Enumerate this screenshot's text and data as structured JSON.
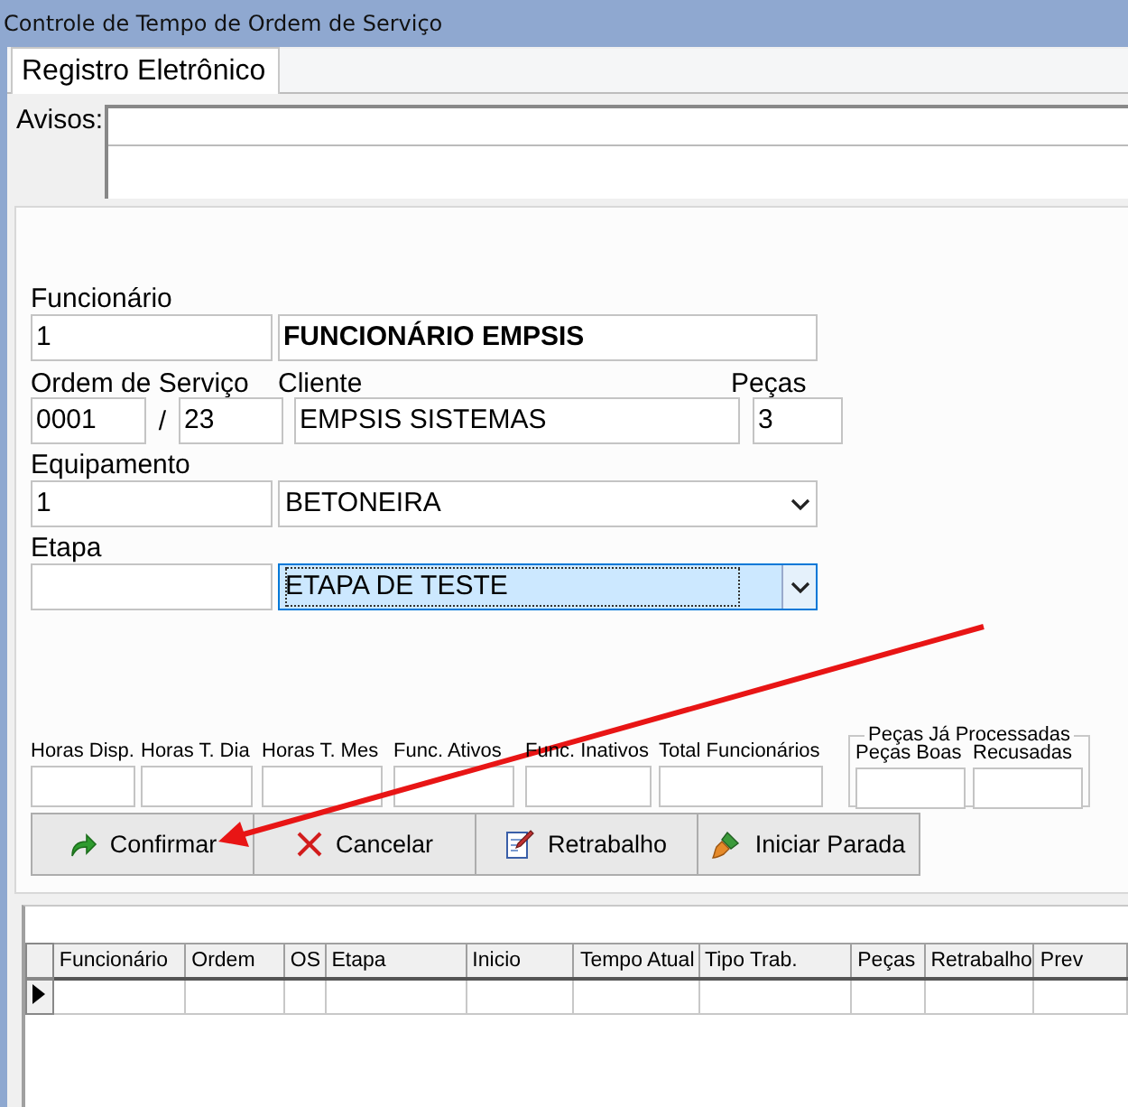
{
  "window": {
    "title": "Controle de Tempo de Ordem de Serviço"
  },
  "tabs": [
    {
      "label": "Registro Eletrônico",
      "selected": true
    }
  ],
  "avisos": {
    "label": "Avisos:"
  },
  "employee": {
    "label": "Funcionário",
    "code": "1",
    "name": "FUNCIONÁRIO EMPSIS"
  },
  "order": {
    "label": "Ordem de Serviço",
    "number": "0001",
    "separator": "/",
    "year": "23"
  },
  "client": {
    "label": "Cliente",
    "value": "EMPSIS SISTEMAS"
  },
  "pieces": {
    "label": "Peças",
    "value": "3"
  },
  "equipment": {
    "label": "Equipamento",
    "code": "1",
    "value": "BETONEIRA",
    "focused": false
  },
  "stage": {
    "label": "Etapa",
    "value": "ETAPA DE TESTE",
    "focused": true
  },
  "stats": [
    {
      "label": "Horas Disp."
    },
    {
      "label": "Horas T. Dia"
    },
    {
      "label": "Horas T. Mes"
    },
    {
      "label": "Func. Ativos"
    },
    {
      "label": "Func. Inativos"
    },
    {
      "label": "Total Funcionários"
    }
  ],
  "processed_group": {
    "title": "Peças Já Processadas",
    "fields": [
      {
        "label": "Peças Boas"
      },
      {
        "label": "Recusadas"
      }
    ]
  },
  "buttons": [
    {
      "label": "Confirmar",
      "kind": "confirm"
    },
    {
      "label": "Cancelar",
      "kind": "cancel"
    },
    {
      "label": "Retrabalho",
      "kind": "rework"
    },
    {
      "label": "Iniciar Parada",
      "kind": "stop"
    }
  ],
  "grid": {
    "columns": [
      "Funcionário",
      "Ordem",
      "OS",
      "Etapa",
      "Inicio",
      "Tempo Atual",
      "Tipo Trab.",
      "Peças",
      "Retrabalho",
      "Prev"
    ],
    "rows": [
      {
        "current": true
      }
    ]
  },
  "annotation": {
    "kind": "arrow"
  }
}
